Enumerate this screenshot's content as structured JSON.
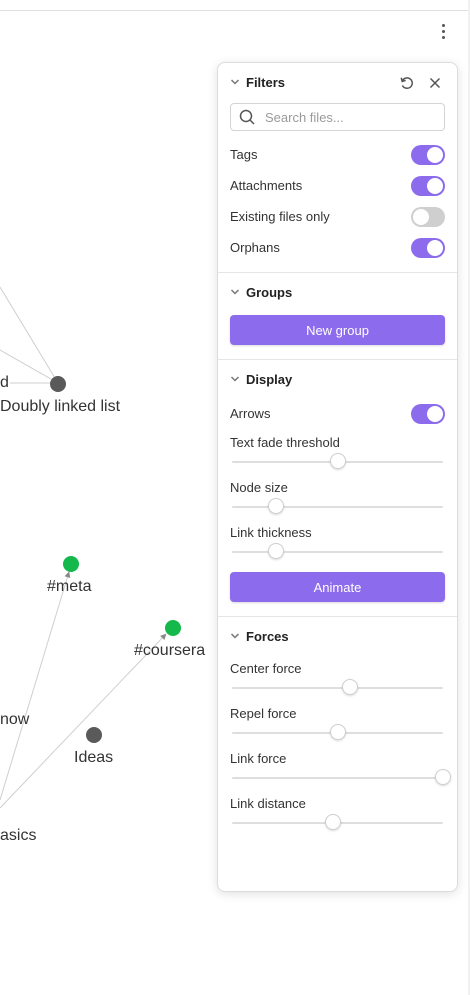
{
  "graph": {
    "nodes": [
      {
        "label": "d",
        "color": "#5a5a5a"
      },
      {
        "label": "Doubly linked list",
        "color": "#5a5a5a"
      },
      {
        "label": "#meta",
        "color": "#14b84b"
      },
      {
        "label": "#coursera",
        "color": "#14b84b"
      },
      {
        "label": "now",
        "color": "#5a5a5a"
      },
      {
        "label": "Ideas",
        "color": "#5a5a5a"
      },
      {
        "label": "asics",
        "color": "#5a5a5a"
      }
    ]
  },
  "menu": {
    "icon": "more-vertical-icon"
  },
  "panel": {
    "filters": {
      "title": "Filters",
      "reset_icon": "reset-icon",
      "close_icon": "close-icon",
      "search_placeholder": "Search files...",
      "search_value": "",
      "toggles": [
        {
          "label": "Tags",
          "on": true
        },
        {
          "label": "Attachments",
          "on": true
        },
        {
          "label": "Existing files only",
          "on": false
        },
        {
          "label": "Orphans",
          "on": true
        }
      ]
    },
    "groups": {
      "title": "Groups",
      "new_group_label": "New group"
    },
    "display": {
      "title": "Display",
      "arrows_label": "Arrows",
      "arrows_on": true,
      "sliders": [
        {
          "label": "Text fade threshold",
          "value": 0.5
        },
        {
          "label": "Node size",
          "value": 0.21
        },
        {
          "label": "Link thickness",
          "value": 0.21
        }
      ],
      "animate_label": "Animate"
    },
    "forces": {
      "title": "Forces",
      "sliders": [
        {
          "label": "Center force",
          "value": 0.56
        },
        {
          "label": "Repel force",
          "value": 0.5
        },
        {
          "label": "Link force",
          "value": 1.0
        },
        {
          "label": "Link distance",
          "value": 0.48
        }
      ]
    }
  },
  "colors": {
    "accent": "#8c6bec",
    "tag_node": "#14b84b",
    "note_node": "#5a5a5a"
  }
}
